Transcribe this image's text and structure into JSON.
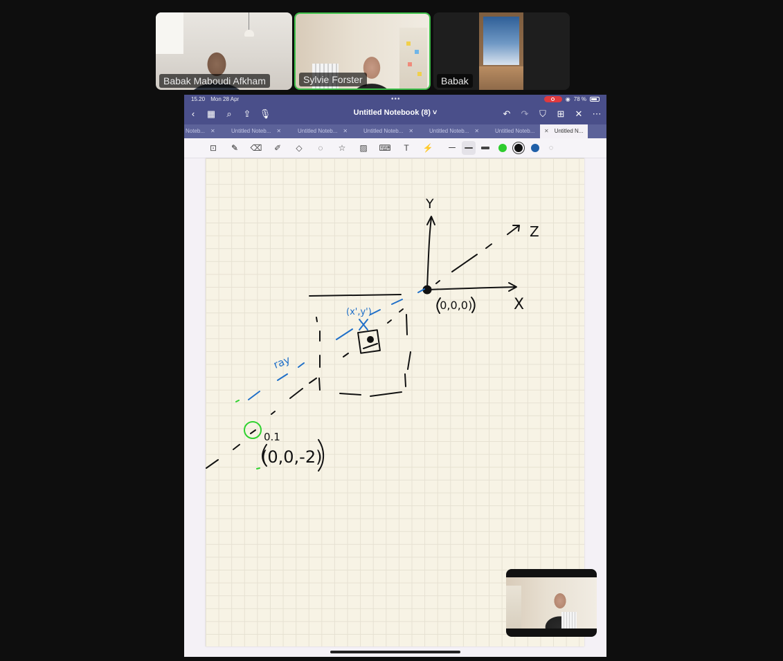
{
  "participants": [
    {
      "name": "Babak Maboudi Afkham"
    },
    {
      "name": "Sylvie Forster"
    },
    {
      "name": "Babak"
    }
  ],
  "status_bar": {
    "time": "15.20",
    "date": "Mon 28 Apr",
    "battery": "78 %"
  },
  "notebook": {
    "title": "Untitled Notebook (8)",
    "title_chevron": "˅"
  },
  "tabs": [
    {
      "label": "Noteb..."
    },
    {
      "label": "Untitled Noteb..."
    },
    {
      "label": "Untitled Noteb..."
    },
    {
      "label": "Untitled Noteb..."
    },
    {
      "label": "Untitled Noteb..."
    },
    {
      "label": "Untitled Noteb..."
    },
    {
      "label": "Untitled N..."
    }
  ],
  "toolbar": {
    "colors": [
      "#2ecc2e",
      "#111111",
      "#1f5fa8"
    ],
    "selected_color": "#111111"
  },
  "drawing": {
    "axis_y": "Y",
    "axis_z": "Z",
    "axis_x": "X",
    "origin_label": "(0,0,0)",
    "projected_label": "(x',y')",
    "ray_label": "ray",
    "camera_label": "0.1",
    "camera_coord": "(0,0,-2)",
    "ink_colors": {
      "black": "#111111",
      "blue": "#1f6fc8",
      "green": "#2fd22f"
    }
  }
}
